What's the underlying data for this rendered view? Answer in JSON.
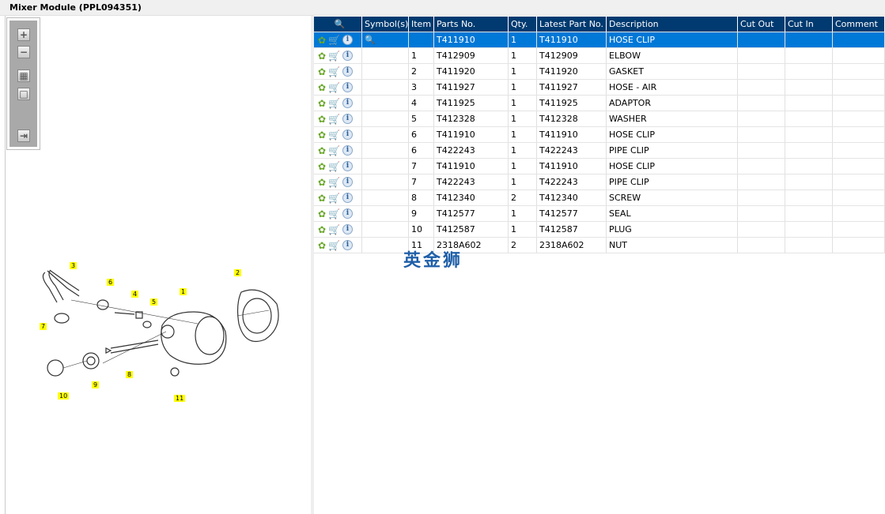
{
  "title": "Mixer Module (PPL094351)",
  "toolbar": {
    "zoom_in": "+",
    "zoom_out": "−",
    "fit": "▦",
    "actual": "□",
    "export": "⇥"
  },
  "diagram": {
    "callouts": [
      "1",
      "2",
      "3",
      "4",
      "5",
      "6",
      "7",
      "8",
      "9",
      "10",
      "11"
    ]
  },
  "watermark": "英金狮",
  "table": {
    "headers": [
      "",
      "Symbol(s)",
      "Item",
      "Parts No.",
      "Qty.",
      "Latest Part No.",
      "Description",
      "Cut Out",
      "Cut In",
      "Comment"
    ],
    "rows": [
      {
        "item": "",
        "part": "T411910",
        "qty": "1",
        "latest": "T411910",
        "desc": "HOSE CLIP",
        "symbol": true,
        "selected": true
      },
      {
        "item": "1",
        "part": "T412909",
        "qty": "1",
        "latest": "T412909",
        "desc": "ELBOW"
      },
      {
        "item": "2",
        "part": "T411920",
        "qty": "1",
        "latest": "T411920",
        "desc": "GASKET"
      },
      {
        "item": "3",
        "part": "T411927",
        "qty": "1",
        "latest": "T411927",
        "desc": "HOSE - AIR"
      },
      {
        "item": "4",
        "part": "T411925",
        "qty": "1",
        "latest": "T411925",
        "desc": "ADAPTOR"
      },
      {
        "item": "5",
        "part": "T412328",
        "qty": "1",
        "latest": "T412328",
        "desc": "WASHER"
      },
      {
        "item": "6",
        "part": "T411910",
        "qty": "1",
        "latest": "T411910",
        "desc": "HOSE CLIP"
      },
      {
        "item": "6",
        "part": "T422243",
        "qty": "1",
        "latest": "T422243",
        "desc": "PIPE CLIP"
      },
      {
        "item": "7",
        "part": "T411910",
        "qty": "1",
        "latest": "T411910",
        "desc": "HOSE CLIP"
      },
      {
        "item": "7",
        "part": "T422243",
        "qty": "1",
        "latest": "T422243",
        "desc": "PIPE CLIP"
      },
      {
        "item": "8",
        "part": "T412340",
        "qty": "2",
        "latest": "T412340",
        "desc": "SCREW"
      },
      {
        "item": "9",
        "part": "T412577",
        "qty": "1",
        "latest": "T412577",
        "desc": "SEAL"
      },
      {
        "item": "10",
        "part": "T412587",
        "qty": "1",
        "latest": "T412587",
        "desc": "PLUG"
      },
      {
        "item": "11",
        "part": "2318A602",
        "qty": "2",
        "latest": "2318A602",
        "desc": "NUT"
      }
    ]
  }
}
